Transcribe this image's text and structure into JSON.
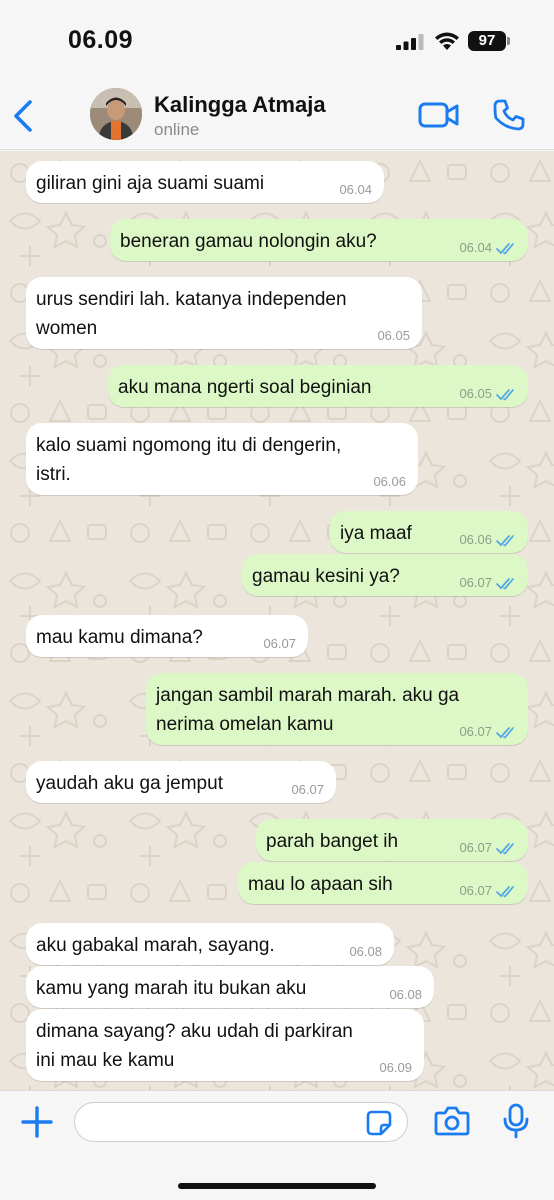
{
  "status_bar": {
    "time": "06.09",
    "battery": "97"
  },
  "header": {
    "contact_name": "Kalingga Atmaja",
    "contact_status": "online"
  },
  "colors": {
    "accent": "#1a7cf0",
    "incoming_bubble": "#ffffff",
    "outgoing_bubble": "#dcf8c6",
    "read_ticks": "#4fa6e6",
    "chat_background": "#ece5dc"
  },
  "messages": [
    {
      "direction": "in",
      "lines": [
        "giliran gini aja suami suami"
      ],
      "time": "06.04"
    },
    {
      "direction": "out",
      "lines": [
        "beneran gamau nolongin aku?"
      ],
      "time": "06.04",
      "status": "read"
    },
    {
      "direction": "in",
      "lines": [
        "urus sendiri lah. katanya independen",
        "women"
      ],
      "time": "06.05"
    },
    {
      "direction": "out",
      "lines": [
        "aku mana ngerti soal beginian"
      ],
      "time": "06.05",
      "status": "read"
    },
    {
      "direction": "in",
      "lines": [
        "kalo suami ngomong itu di dengerin,",
        "istri."
      ],
      "time": "06.06"
    },
    {
      "direction": "out",
      "lines": [
        "iya maaf"
      ],
      "time": "06.06",
      "status": "read"
    },
    {
      "direction": "out",
      "lines": [
        "gamau kesini ya?"
      ],
      "time": "06.07",
      "status": "read"
    },
    {
      "direction": "in",
      "lines": [
        "mau kamu dimana?"
      ],
      "time": "06.07"
    },
    {
      "direction": "out",
      "lines": [
        "jangan sambil marah marah. aku ga",
        "nerima omelan kamu"
      ],
      "time": "06.07",
      "status": "read"
    },
    {
      "direction": "in",
      "lines": [
        "yaudah aku ga jemput"
      ],
      "time": "06.07"
    },
    {
      "direction": "out",
      "lines": [
        "parah banget ih"
      ],
      "time": "06.07",
      "status": "read"
    },
    {
      "direction": "out",
      "lines": [
        "mau lo apaan sih"
      ],
      "time": "06.07",
      "status": "read"
    },
    {
      "direction": "in",
      "lines": [
        "aku gabakal marah, sayang."
      ],
      "time": "06.08"
    },
    {
      "direction": "in",
      "lines": [
        "kamu yang marah itu bukan aku"
      ],
      "time": "06.08"
    },
    {
      "direction": "in",
      "lines": [
        "dimana sayang? aku udah di parkiran",
        "ini mau ke kamu"
      ],
      "time": "06.09"
    }
  ],
  "input": {
    "value": "",
    "placeholder": ""
  },
  "icons": {
    "back": "chevron-left-icon",
    "video": "video-camera-icon",
    "call": "phone-icon",
    "plus": "plus-icon",
    "sticker": "sticker-icon",
    "camera": "camera-icon",
    "mic": "microphone-icon",
    "read_receipt": "double-check-icon"
  }
}
